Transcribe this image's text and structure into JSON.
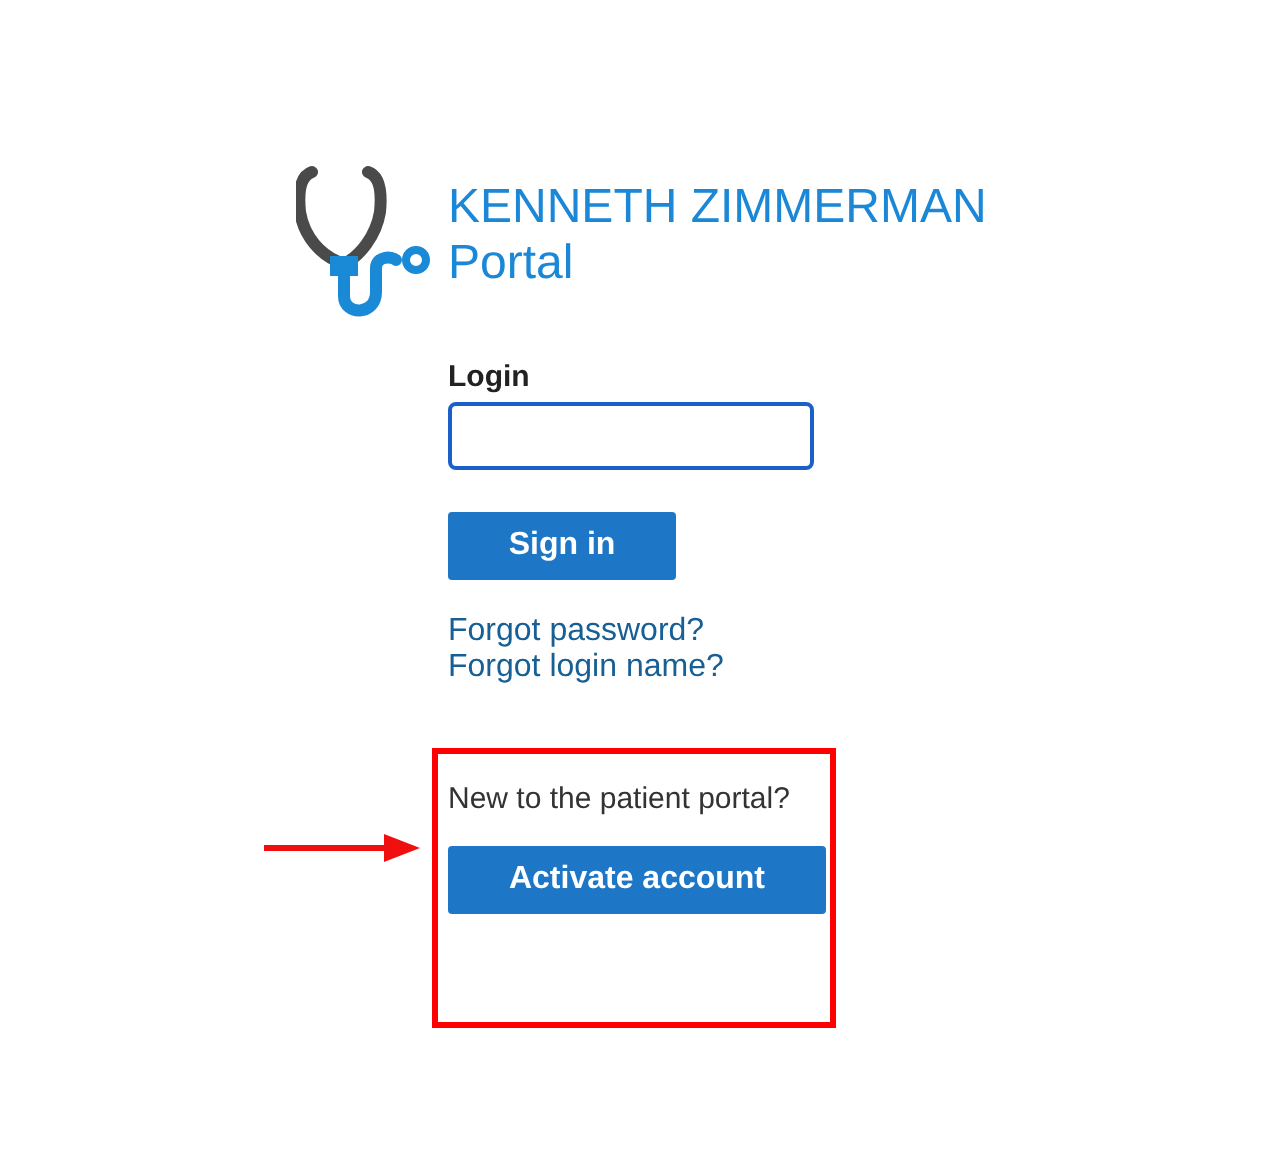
{
  "header": {
    "title": "KENNETH ZIMMERMAN",
    "subtitle": "Portal"
  },
  "login": {
    "label": "Login"
  },
  "sign_in_button": "Sign in",
  "links": [
    "Forgot password?",
    "Forgot login name?"
  ],
  "activation": {
    "prompt": "New to the patient portal?",
    "button": "Activate account"
  }
}
